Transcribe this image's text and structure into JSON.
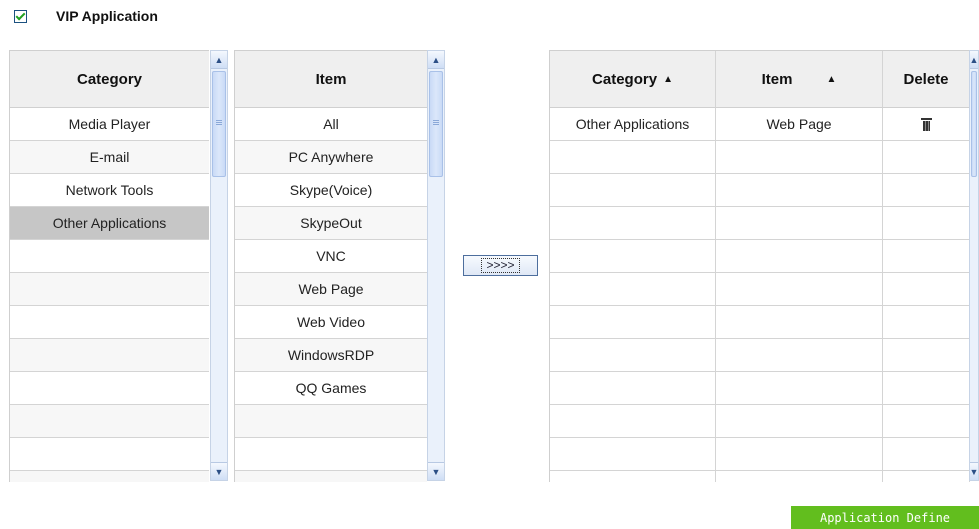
{
  "vip": {
    "label": "VIP Application",
    "checked": true
  },
  "categories": {
    "header": "Category",
    "items": [
      "Media Player",
      "E-mail",
      "Network Tools",
      "Other Applications"
    ],
    "selected": "Other Applications"
  },
  "items": {
    "header": "Item",
    "list": [
      "All",
      "PC Anywhere",
      "Skype(Voice)",
      "SkypeOut",
      "VNC",
      "Web Page",
      "Web Video",
      "WindowsRDP",
      "QQ Games"
    ]
  },
  "transfer_button": {
    "label": ">>>>"
  },
  "selected_table": {
    "headers": {
      "category": "Category",
      "item": "Item",
      "delete": "Delete"
    },
    "sort_indicator": "▲",
    "rows": [
      {
        "category": "Other Applications",
        "item": "Web Page",
        "delete_icon": "trash-icon"
      }
    ]
  },
  "footer": {
    "application_define": "Application Define"
  },
  "colors": {
    "accent_green": "#62be1e",
    "selected_row": "#c6c6c6",
    "header_bg": "#efefef"
  }
}
